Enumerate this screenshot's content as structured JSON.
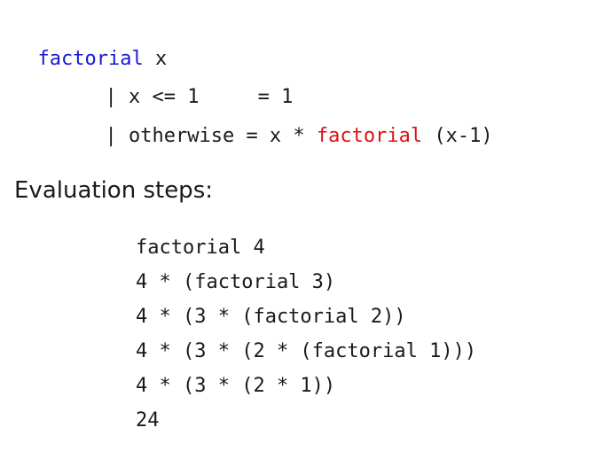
{
  "code": {
    "header": {
      "name": "factorial",
      "arg": " x"
    },
    "guard1": {
      "text": "| x <= 1     = 1"
    },
    "guard2": {
      "prefix": "| otherwise = x * ",
      "call": "factorial",
      "suffix": " (x-1)"
    }
  },
  "evaluation": {
    "heading": "Evaluation steps:",
    "steps": [
      "factorial 4",
      "4 * (factorial 3)",
      "4 * (3 * (factorial 2))",
      "4 * (3 * (2 * (factorial 1)))",
      "4 * (3 * (2 * 1))",
      "24"
    ]
  },
  "colors": {
    "function_name": "#1a1ad0",
    "recursive_call": "#e01010",
    "text": "#1a1a1a"
  }
}
